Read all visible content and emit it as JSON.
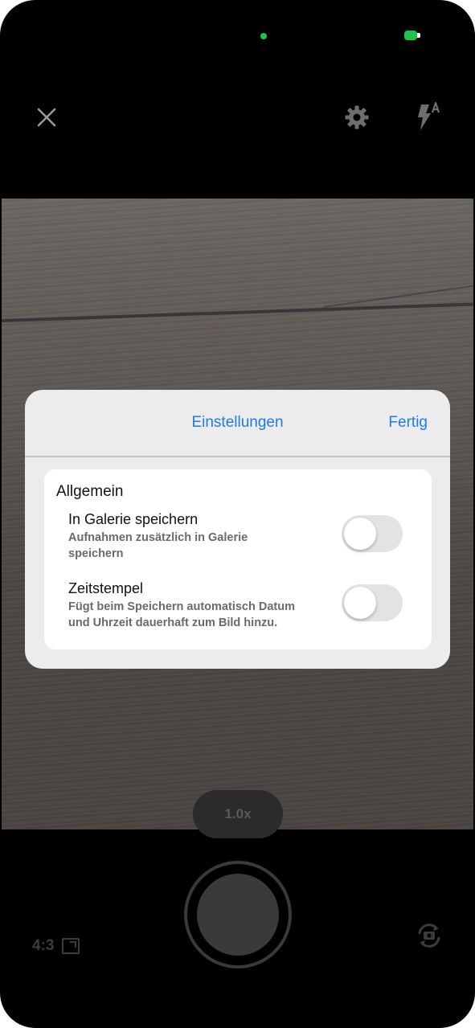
{
  "camera": {
    "zoom_label": "1.0x",
    "aspect_ratio_label": "4:3"
  },
  "settings_sheet": {
    "title": "Einstellungen",
    "done_label": "Fertig",
    "section_title": "Allgemein",
    "options": [
      {
        "title": "In Galerie speichern",
        "description": "Aufnahmen zusätzlich in Galerie speichern",
        "enabled": false
      },
      {
        "title": "Zeitstempel",
        "description": "Fügt beim Speichern automatisch Datum und Uhrzeit dauerhaft zum Bild hinzu.",
        "enabled": false
      }
    ]
  },
  "icons": {
    "close": "close-icon",
    "settings": "gear-icon",
    "flash": "flash-auto-icon",
    "aspect_ratio": "aspect-ratio-icon",
    "switch_camera": "switch-camera-icon"
  },
  "colors": {
    "accent": "#1f7be8",
    "status_green": "#1fc24a",
    "background": "#000000"
  }
}
